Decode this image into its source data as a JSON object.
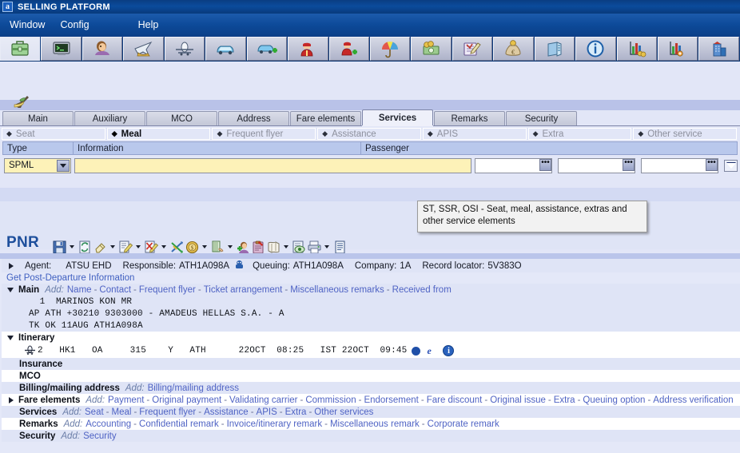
{
  "window": {
    "title": "SELLING PLATFORM",
    "icon_letter": "a"
  },
  "menu": {
    "items": [
      {
        "label": "Window"
      },
      {
        "label": "Config"
      },
      {
        "label": "Help"
      }
    ]
  },
  "toolbar": {
    "buttons": [
      {
        "name": "briefcase-icon",
        "title": "Briefcase"
      },
      {
        "name": "terminal-icon",
        "title": "Command page"
      },
      {
        "name": "customer-icon",
        "title": "Customer profile"
      },
      {
        "name": "air-booking-icon",
        "title": "Air booking"
      },
      {
        "name": "air-availability-icon",
        "title": "Air availability"
      },
      {
        "name": "car-icon",
        "title": "Car availability"
      },
      {
        "name": "car-add-icon",
        "title": "Car sell"
      },
      {
        "name": "hotel-icon",
        "title": "Hotel availability"
      },
      {
        "name": "hotel-add-icon",
        "title": "Hotel sell"
      },
      {
        "name": "insurance-icon",
        "title": "Insurance"
      },
      {
        "name": "fares-icon",
        "title": "Fares"
      },
      {
        "name": "ticket-icon",
        "title": "Ticketing"
      },
      {
        "name": "cash-icon",
        "title": "Cash / money"
      },
      {
        "name": "file-icon",
        "title": "Documents"
      },
      {
        "name": "info-icon",
        "title": "Information"
      },
      {
        "name": "reports-icon",
        "title": "Reports"
      },
      {
        "name": "reports-add-icon",
        "title": "Add report"
      },
      {
        "name": "office-icon",
        "title": "Office"
      }
    ]
  },
  "panel": {
    "section_icon": "meal-icon",
    "tabs": [
      {
        "label": "Main",
        "active": false
      },
      {
        "label": "Auxiliary",
        "active": false
      },
      {
        "label": "MCO",
        "active": false
      },
      {
        "label": "Address",
        "active": false
      },
      {
        "label": "Fare elements",
        "active": false
      },
      {
        "label": "Services",
        "active": true
      },
      {
        "label": "Remarks",
        "active": false
      },
      {
        "label": "Security",
        "active": false
      }
    ],
    "subtabs": [
      {
        "label": "Seat",
        "active": false
      },
      {
        "label": "Meal",
        "active": true
      },
      {
        "label": "Frequent flyer",
        "active": false
      },
      {
        "label": "Assistance",
        "active": false
      },
      {
        "label": "APIS",
        "active": false
      },
      {
        "label": "Extra",
        "active": false
      },
      {
        "label": "Other service",
        "active": false
      }
    ],
    "grid": {
      "headers": {
        "type": "Type",
        "information": "Information",
        "passenger": "Passenger"
      },
      "type_value": "SPML",
      "information_value": "",
      "passengers": [
        "",
        "",
        ""
      ],
      "pax_button_label": "•••"
    },
    "tooltip": "ST, SSR, OSI - Seat, meal, assistance, extras and other service elements"
  },
  "pnr": {
    "title": "PNR",
    "toolbar": [
      {
        "name": "save-icon",
        "caret": true
      },
      {
        "name": "refresh-icon",
        "caret": false
      },
      {
        "name": "erase-icon",
        "caret": true
      },
      {
        "name": "edit-icon",
        "caret": true
      },
      {
        "name": "cancel-edit-icon",
        "caret": true
      },
      {
        "name": "split-icon",
        "caret": false
      },
      {
        "name": "pricing-icon",
        "caret": true
      },
      {
        "name": "history-icon",
        "caret": true
      },
      {
        "name": "add-passenger-icon",
        "caret": false
      },
      {
        "name": "clipboard-icon",
        "caret": false
      },
      {
        "name": "itinerary-icon",
        "caret": true
      },
      {
        "name": "view-icon",
        "caret": false
      },
      {
        "name": "print-icon",
        "caret": true
      },
      {
        "name": "list-icon",
        "caret": false
      }
    ],
    "header": {
      "agent_label": "Agent:",
      "agent_value": "ATSU EHD",
      "responsible_label": "Responsible:",
      "responsible_value": "ATH1A098A",
      "queue_icon": "queue-icon",
      "queuing_label": "Queuing:",
      "queuing_value": "ATH1A098A",
      "company_label": "Company:",
      "company_value": "1A",
      "record_locator_label": "Record locator:",
      "record_locator_value": "5V383O"
    },
    "post_departure_link": "Get Post-Departure Information",
    "sections": {
      "main": {
        "label": "Main",
        "add_label": "Add:",
        "links": [
          "Name",
          "Contact",
          "Frequent flyer",
          "Ticket arrangement",
          "Miscellaneous remarks",
          "Received from"
        ],
        "rows": [
          "  1  MARINOS KON MR",
          "AP ATH +30210 9303000 - AMADEUS HELLAS S.A. - A",
          "TK OK 11AUG ATH1A098A"
        ]
      },
      "itinerary": {
        "label": "Itinerary",
        "segment": {
          "icon": "airplane-icon",
          "line": "2   HK1   OA     315    Y   ATH      22OCT  08:25   IST 22OCT  09:45",
          "trailing_icons": [
            "seat-map-icon",
            "e-ticket-icon",
            "info-icon"
          ]
        }
      },
      "insurance": {
        "label": "Insurance"
      },
      "mco": {
        "label": "MCO"
      },
      "billing": {
        "label": "Billing/mailing address",
        "add_label": "Add:",
        "links": [
          "Billing/mailing address"
        ]
      },
      "fare_elements": {
        "label": "Fare elements",
        "add_label": "Add:",
        "links": [
          "Payment",
          "Original payment",
          "Validating carrier",
          "Commission",
          "Endorsement",
          "Fare discount",
          "Original issue",
          "Extra",
          "Queuing option",
          "Address verification"
        ]
      },
      "services": {
        "label": "Services",
        "add_label": "Add:",
        "links": [
          "Seat",
          "Meal",
          "Frequent flyer",
          "Assistance",
          "APIS",
          "Extra",
          "Other services"
        ]
      },
      "remarks": {
        "label": "Remarks",
        "add_label": "Add:",
        "links": [
          "Accounting",
          "Confidential remark",
          "Invoice/itinerary remark",
          "Miscellaneous remark",
          "Corporate remark"
        ]
      },
      "security": {
        "label": "Security",
        "add_label": "Add:",
        "links": [
          "Security"
        ]
      }
    }
  },
  "colors": {
    "title_bar": "#0b4b9c",
    "menu_bar": "#0d4a99",
    "workspace": "#e2e6f7",
    "grid_header": "#b9c8ec",
    "input_yellow": "#fdf2b8",
    "link": "#4f63c4",
    "pnr_title": "#1e4f9c"
  }
}
